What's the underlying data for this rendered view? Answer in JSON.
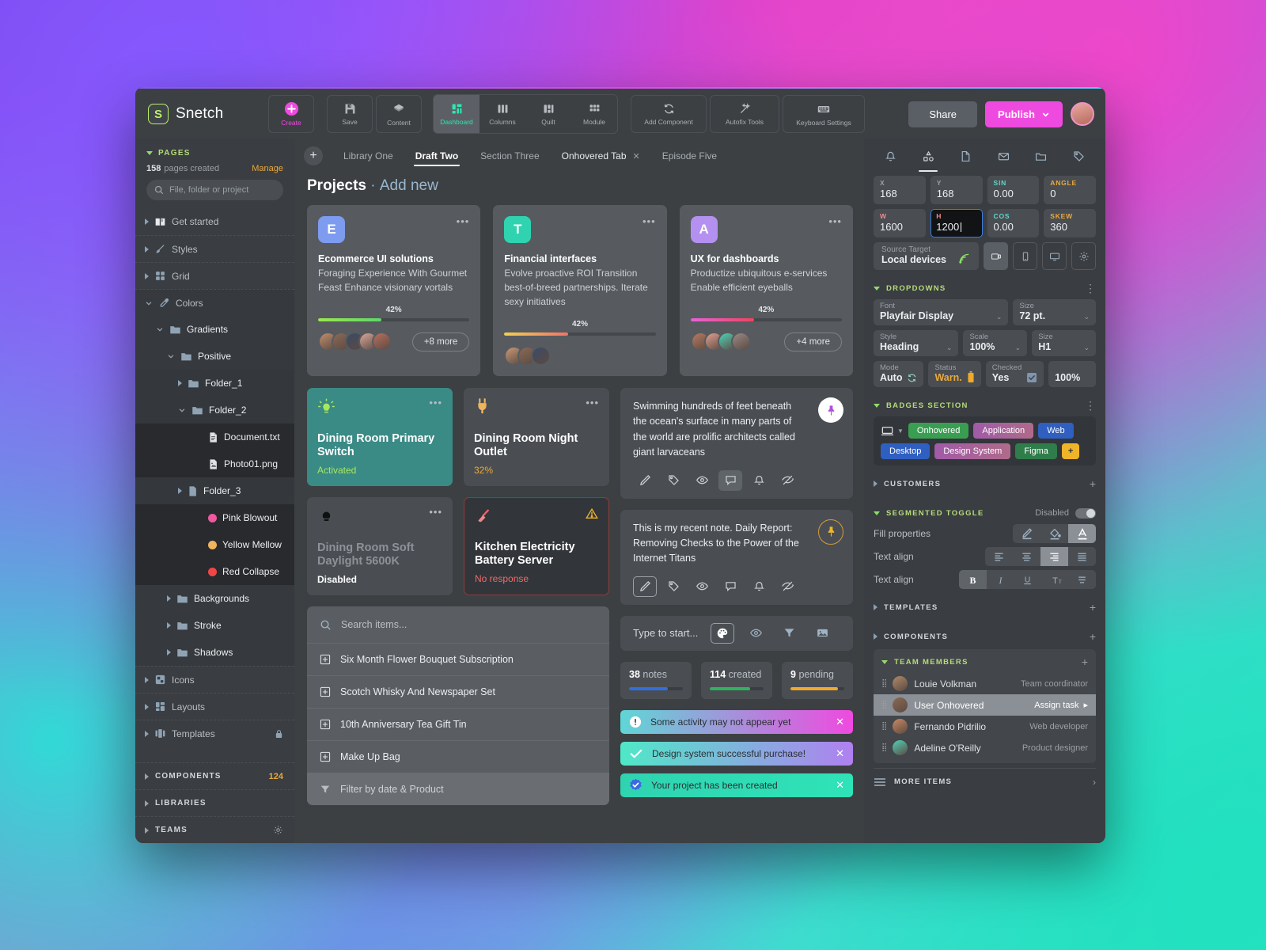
{
  "app": {
    "brand": "Snetch",
    "brand_initial": "S",
    "create_label": "Create"
  },
  "toolbar": {
    "groups": [
      {
        "items": [
          {
            "label": "Save",
            "icon": "save-icon"
          },
          {
            "label": "Content",
            "icon": "layers-icon"
          }
        ]
      },
      {
        "items": [
          {
            "label": "Dashboard",
            "icon": "dashboard-icon",
            "active": true
          },
          {
            "label": "Columns",
            "icon": "columns-icon"
          },
          {
            "label": "Quilt",
            "icon": "quilt-icon"
          },
          {
            "label": "Module",
            "icon": "module-icon"
          }
        ]
      },
      {
        "items": [
          {
            "label": "Add Component",
            "icon": "refresh-icon"
          },
          {
            "label": "Autofix Tools",
            "icon": "magic-wand-icon"
          },
          {
            "label": "Keyboard Settings",
            "icon": "keyboard-icon"
          }
        ]
      }
    ],
    "share_label": "Share",
    "publish_label": "Publish"
  },
  "sidebar": {
    "pages_label": "PAGES",
    "pages_count": "158",
    "pages_created_suffix": "pages created",
    "manage_label": "Manage",
    "search_placeholder": "File, folder or project",
    "tree": [
      {
        "label": "Get started",
        "icon": "book-icon",
        "level": 0,
        "state": "collapsed"
      },
      {
        "label": "Styles",
        "icon": "brush-icon",
        "level": 0,
        "state": "collapsed"
      },
      {
        "label": "Grid",
        "icon": "grid-icon",
        "level": 0,
        "state": "collapsed"
      },
      {
        "label": "Colors",
        "icon": "eyedropper-icon",
        "level": 0,
        "state": "expanded"
      },
      {
        "label": "Gradients",
        "icon": "folder-icon",
        "level": 1,
        "state": "expanded"
      },
      {
        "label": "Positive",
        "icon": "folder-icon",
        "level": 2,
        "state": "expanded"
      },
      {
        "label": "Folder_1",
        "icon": "folder-icon",
        "level": 3,
        "state": "collapsed"
      },
      {
        "label": "Folder_2",
        "icon": "folder-icon",
        "level": 3,
        "state": "expanded"
      },
      {
        "label": "Document.txt",
        "icon": "document-icon",
        "level": 4,
        "state": "file"
      },
      {
        "label": "Photo01.png",
        "icon": "image-icon",
        "level": 4,
        "state": "file"
      },
      {
        "label": "Folder_3",
        "icon": "file-icon",
        "level": 3,
        "state": "collapsed"
      },
      {
        "label": "Pink Blowout",
        "icon": "color-dot",
        "level": 4,
        "state": "swatch",
        "color": "#f0589f"
      },
      {
        "label": "Yellow Mellow",
        "icon": "color-dot",
        "level": 4,
        "state": "swatch",
        "color": "#f0b35e"
      },
      {
        "label": "Red Collapse",
        "icon": "color-dot",
        "level": 4,
        "state": "swatch",
        "color": "#f04646"
      },
      {
        "label": "Backgrounds",
        "icon": "folder-icon",
        "level": 2,
        "state": "collapsed"
      },
      {
        "label": "Stroke",
        "icon": "folder-icon",
        "level": 2,
        "state": "collapsed"
      },
      {
        "label": "Shadows",
        "icon": "folder-icon",
        "level": 2,
        "state": "collapsed"
      },
      {
        "label": "Icons",
        "icon": "icons-icon",
        "level": 0,
        "state": "collapsed"
      },
      {
        "label": "Layouts",
        "icon": "layouts-icon",
        "level": 0,
        "state": "collapsed"
      },
      {
        "label": "Templates",
        "icon": "templates-icon",
        "level": 0,
        "state": "collapsed",
        "lock": true
      }
    ],
    "sections": [
      {
        "label": "COMPONENTS",
        "count": "124"
      },
      {
        "label": "LIBRARIES",
        "count": ""
      },
      {
        "label": "TEAMS",
        "count": ""
      }
    ]
  },
  "tabs": {
    "add_label": "+",
    "items": [
      {
        "label": "Library One",
        "active": false
      },
      {
        "label": "Draft Two",
        "active": true
      },
      {
        "label": "Section Three",
        "active": false
      },
      {
        "label": "Onhovered Tab",
        "active": false,
        "closable": true
      },
      {
        "label": "Episode Five",
        "active": false
      }
    ]
  },
  "main": {
    "page_title": "Projects",
    "page_title_separator": "·",
    "page_title_action": "Add new",
    "projects": [
      {
        "initial": "E",
        "icon_color": "#7d9bef",
        "title": "Ecommerce UI solutions",
        "description": "Foraging Experience With Gourmet Feast Enhance visionary vortals",
        "percent": "42%",
        "progress": 42,
        "bar_from": "#9ae84f",
        "bar_to": "#5fd66a",
        "avatars": [
          "#c08f6e",
          "#8a6a55",
          "#3a4a66",
          "#d8a89a",
          "#b7705e"
        ],
        "more_label": "+8 more"
      },
      {
        "initial": "T",
        "icon_color": "#2fd3b0",
        "title": "Financial interfaces",
        "description": "Evolve proactive ROI Transition best-of-breed partnerships. Iterate sexy initiatives",
        "percent": "42%",
        "progress": 42,
        "bar_from": "#f0d14f",
        "bar_to": "#f0736a",
        "avatars": [
          "#c89a78",
          "#8a6a55",
          "#3a4a66"
        ],
        "more_label": ""
      },
      {
        "initial": "A",
        "icon_color": "#b490f0",
        "title": "UX for dashboards",
        "description": "Productize ubiquitous e-services Enable efficient eyeballs",
        "percent": "42%",
        "progress": 42,
        "bar_from": "#e862d8",
        "bar_to": "#f0435f",
        "avatars": [
          "#b77a62",
          "#e0a090",
          "#4fd3b8",
          "#9a8a86"
        ],
        "more_label": "+4 more"
      }
    ],
    "devices": [
      {
        "icon": "bulb-on-icon",
        "title": "Dining Room Primary Switch",
        "status": "Activated",
        "variant": "teal",
        "status_class": "green"
      },
      {
        "icon": "plug-icon",
        "title": "Dining Room Night Outlet",
        "status": "32%",
        "variant": "plain",
        "status_class": "amber"
      },
      {
        "icon": "bulb-off-icon",
        "title": "Dining Room Soft Daylight 5600K",
        "status": "Disabled",
        "variant": "plain",
        "status_class": "white",
        "dim": true
      },
      {
        "icon": "broom-icon",
        "title": "Kitchen Electricity Battery Server",
        "status": "No response",
        "variant": "alert",
        "status_class": "red",
        "warn": true
      }
    ],
    "item_list": {
      "search_placeholder": "Search items...",
      "items": [
        "Six Month Flower Bouquet Subscription",
        "Scotch Whisky And Newspaper Set",
        "10th Anniversary Tea Gift Tin",
        "Make Up Bag"
      ],
      "filter_label": "Filter by date & Product"
    },
    "notes": [
      {
        "text": "Swimming hundreds of feet beneath the ocean's surface in many parts of the world are prolific architects called giant larvaceans",
        "pin_style": "white",
        "pin_color": "#b14fe0",
        "actions": [
          {
            "icon": "pencil-icon",
            "state": "normal"
          },
          {
            "icon": "tag-icon",
            "state": "normal"
          },
          {
            "icon": "eye-icon",
            "state": "normal"
          },
          {
            "icon": "comment-icon",
            "state": "filled"
          },
          {
            "icon": "bell-icon",
            "state": "normal"
          },
          {
            "icon": "eye-off-icon",
            "state": "normal"
          }
        ]
      },
      {
        "text": "This is my recent note. Daily Report: Removing Checks to the Power of the Internet Titans",
        "pin_style": "ring",
        "pin_color": "#f0b429",
        "actions": [
          {
            "icon": "pencil-icon",
            "state": "outline"
          },
          {
            "icon": "tag-icon",
            "state": "normal"
          },
          {
            "icon": "eye-icon",
            "state": "normal"
          },
          {
            "icon": "comment-icon",
            "state": "normal"
          },
          {
            "icon": "bell-icon",
            "state": "normal"
          },
          {
            "icon": "eye-off-icon",
            "state": "normal"
          }
        ]
      }
    ],
    "typebar": {
      "placeholder": "Type to start...",
      "actions": [
        "palette-icon",
        "eye-icon",
        "filter-icon",
        "image-icon"
      ]
    },
    "stats": [
      {
        "value": "38",
        "label": "notes",
        "progress": 72,
        "color": "#2f6fe0"
      },
      {
        "value": "114",
        "label": "created",
        "progress": 75,
        "color": "#2fb35f"
      },
      {
        "value": "9",
        "label": "pending",
        "progress": 88,
        "color": "#f0a929"
      }
    ],
    "toasts": [
      {
        "text": "Some activity may not appear yet",
        "icon": "info-icon",
        "from": "#5fd6d6",
        "to": "#ef4adf"
      },
      {
        "text": "Design system successful purchase!",
        "icon": "check-icon",
        "from": "#4fe8c8",
        "to": "#b080f0"
      },
      {
        "text": "Your project has been created",
        "icon": "verified-icon",
        "from": "#2fd3b0",
        "to": "#2fe3b8"
      }
    ]
  },
  "rightpanel": {
    "icons": [
      "bell-icon",
      "shapes-icon",
      "file-icon",
      "mail-icon",
      "folder-icon",
      "tag-icon"
    ],
    "transform": [
      {
        "label": "X",
        "value": "168",
        "color": "grey"
      },
      {
        "label": "Y",
        "value": "168",
        "color": "grey"
      },
      {
        "label": "SIN",
        "value": "0.00",
        "color": "cyan"
      },
      {
        "label": "ANGLE",
        "value": "0",
        "color": "amber"
      },
      {
        "label": "W",
        "value": "1600",
        "color": "pink"
      },
      {
        "label": "H",
        "value": "1200",
        "color": "pink",
        "focused": true
      },
      {
        "label": "COS",
        "value": "0.00",
        "color": "cyan"
      },
      {
        "label": "SKEW",
        "value": "360",
        "color": "amber"
      }
    ],
    "source": {
      "label": "Source Target",
      "value": "Local devices",
      "buttons": [
        "device-icon",
        "phone-icon",
        "monitor-icon",
        "gear-icon"
      ]
    },
    "dropdowns_title": "DROPDOWNS",
    "dropdowns": [
      {
        "label": "Font",
        "value": "Playfair Display",
        "width": "wide"
      },
      {
        "label": "Size",
        "value": "72 pt.",
        "width": "narrow"
      },
      {
        "label": "Style",
        "value": "Heading",
        "width": "mid"
      },
      {
        "label": "Scale",
        "value": "100%",
        "width": "mid"
      },
      {
        "label": "Size",
        "value": "H1",
        "width": "mid"
      },
      {
        "label": "Mode",
        "value": "Auto",
        "width": "mid",
        "icon": "refresh-icon"
      },
      {
        "label": "Status",
        "value": "Warn.",
        "width": "mid",
        "icon": "battery-icon",
        "amber": true
      },
      {
        "label": "Checked",
        "value": "Yes",
        "width": "mid",
        "icon": "checkbox-icon"
      },
      {
        "label": "",
        "value": "100%",
        "width": "mid"
      }
    ],
    "badges_title": "BADGES SECTION",
    "badges": [
      {
        "label": "Onhovered",
        "bg": "#3a9e52"
      },
      {
        "label": "Application",
        "bg": "linear-gradient(90deg,#a05ba8,#b06a8a)"
      },
      {
        "label": "Web",
        "bg": "#2f5fc0"
      },
      {
        "label": "Desktop",
        "bg": "#2f5fc0"
      },
      {
        "label": "Design System",
        "bg": "linear-gradient(90deg,#a05ba8,#b06a8a)"
      },
      {
        "label": "Figma",
        "bg": "#2f7d4a"
      },
      {
        "label": "+",
        "bg": "#f0b429",
        "plus": true
      }
    ],
    "customers_title": "CUSTOMERS",
    "segmented_title": "SEGMENTED TOGGLE",
    "segmented_state": "Disabled",
    "segmented_rows": [
      {
        "label": "Fill properties",
        "options": [
          "pen-icon",
          "bucket-icon",
          "text-color-icon"
        ],
        "selected": 2
      },
      {
        "label": "Text align",
        "options": [
          "align-left-icon",
          "align-center-icon",
          "align-right-icon",
          "align-justify-icon"
        ],
        "selected": 2
      },
      {
        "label": "Text align",
        "options": [
          "bold-icon",
          "italic-icon",
          "underline-icon",
          "font-size-icon",
          "strikethrough-icon"
        ],
        "selected": 0
      }
    ],
    "templates_title": "TEMPLATES",
    "components_title": "COMPONENTS",
    "team_title": "TEAM MEMBERS",
    "team": [
      {
        "name": "Louie Volkman",
        "role": "Team coordinator",
        "color": "#b08a6a",
        "selected": false
      },
      {
        "name": "User Onhovered",
        "role": "Assign task",
        "color": "#8a6a55",
        "selected": true
      },
      {
        "name": "Fernando Pidrilio",
        "role": "Web developer",
        "color": "#c98a62",
        "selected": false
      },
      {
        "name": "Adeline O'Reilly",
        "role": "Product designer",
        "color": "#4fd3b8",
        "selected": false
      }
    ],
    "more_items_label": "MORE ITEMS"
  }
}
